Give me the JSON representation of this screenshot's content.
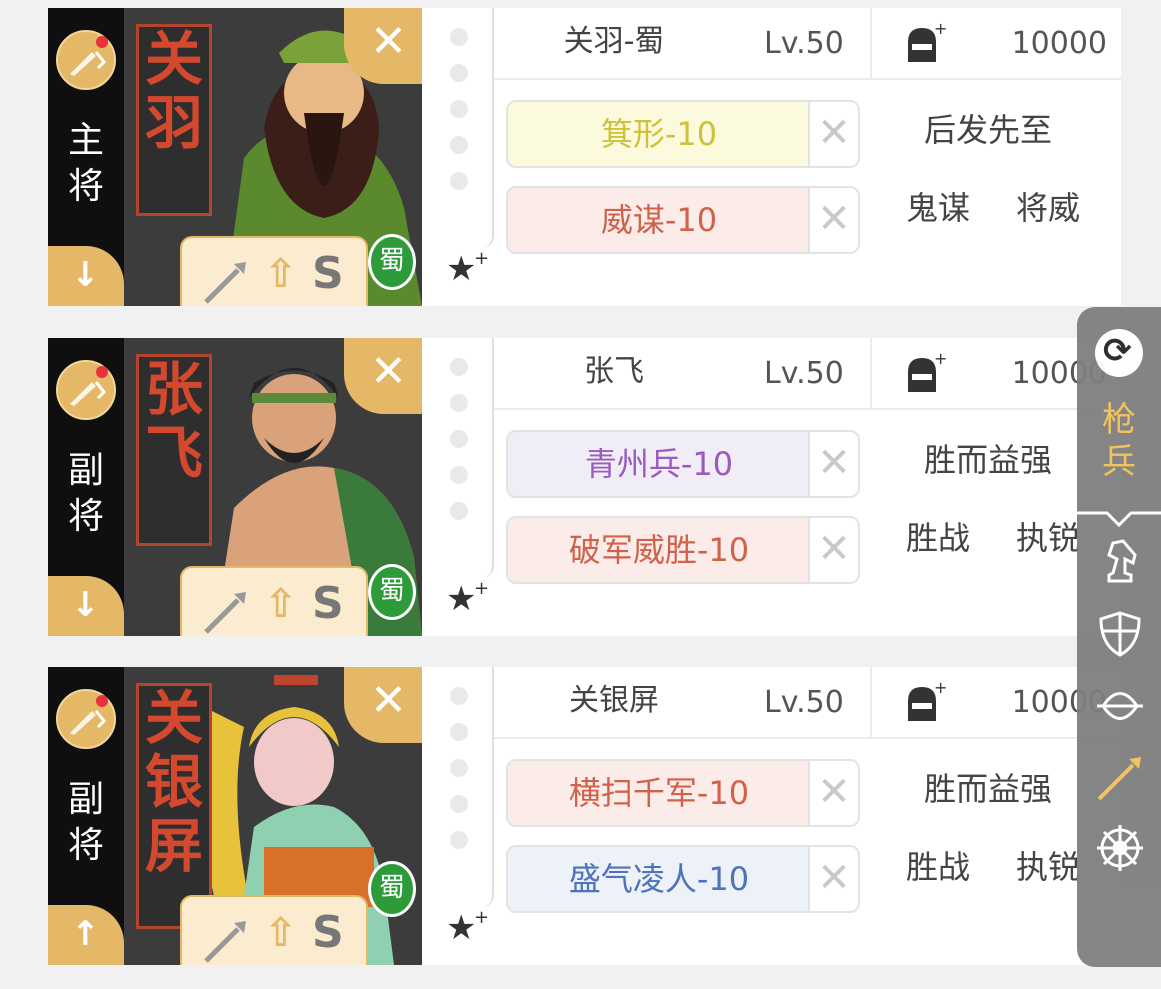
{
  "cards": [
    {
      "rank": [
        "主",
        "将"
      ],
      "banner": [
        "关",
        "羽"
      ],
      "kingdom": "蜀",
      "arrow": "↓",
      "name": "关羽-蜀",
      "level": "Lv.50",
      "power": "10000",
      "grade": "S",
      "tactics": [
        {
          "label": "箕形-10",
          "bg": "#fbfadd",
          "color": "#cfc23a"
        },
        {
          "label": "威谋-10",
          "bg": "#fbece9",
          "color": "#d0624a"
        }
      ],
      "traits": {
        "top": "后发先至",
        "left": "鬼谋",
        "right": "将威"
      },
      "accent": "#5b8a2e"
    },
    {
      "rank": [
        "副",
        "将"
      ],
      "banner": [
        "张",
        "飞"
      ],
      "kingdom": "蜀",
      "arrow": "↓",
      "name": "张飞",
      "level": "Lv.50",
      "power": "10000",
      "grade": "S",
      "tactics": [
        {
          "label": "青州兵-10",
          "bg": "#f1edf6",
          "color": "#9a5bbd"
        },
        {
          "label": "破军威胜-10",
          "bg": "#fbece9",
          "color": "#d0624a"
        }
      ],
      "traits": {
        "top": "胜而益强",
        "left": "胜战",
        "right": "执锐"
      },
      "accent": "#3a7a3a"
    },
    {
      "rank": [
        "副",
        "将"
      ],
      "banner": [
        "关",
        "银",
        "屏"
      ],
      "kingdom": "蜀",
      "arrow": "↑",
      "name": "关银屏",
      "level": "Lv.50",
      "power": "10000",
      "grade": "S",
      "tactics": [
        {
          "label": "横扫千军-10",
          "bg": "#fbece9",
          "color": "#d0624a"
        },
        {
          "label": "盛气凌人-10",
          "bg": "#edf1f8",
          "color": "#4f73b8"
        }
      ],
      "traits": {
        "top": "胜而益强",
        "left": "胜战",
        "right": "执锐"
      },
      "accent": "#e8c23a"
    }
  ],
  "side_panel": {
    "troop": [
      "枪",
      "兵"
    ],
    "troop_color": "#f3c055",
    "icons": [
      "cavalry-icon",
      "shield-icon",
      "bow-icon",
      "spear-icon",
      "wheel-icon"
    ]
  },
  "colors": {
    "gold": "#e4b866",
    "rail": "#0f0f0f",
    "badge_red": "#e8313c",
    "kingdom_green": "#2e9b3b"
  }
}
